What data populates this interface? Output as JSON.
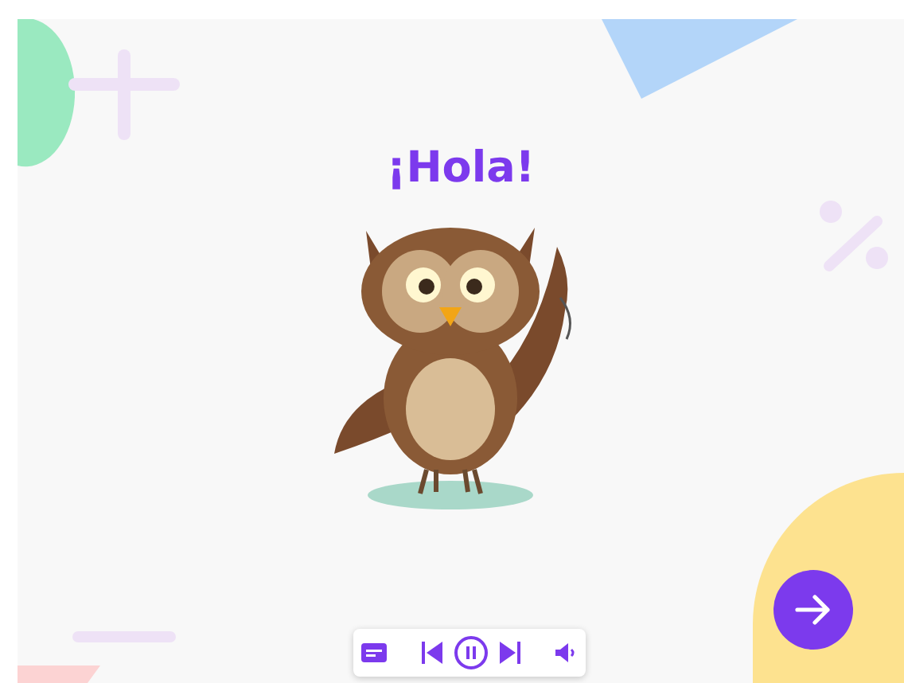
{
  "title": "¡Hola!",
  "player": {
    "playing": true
  }
}
